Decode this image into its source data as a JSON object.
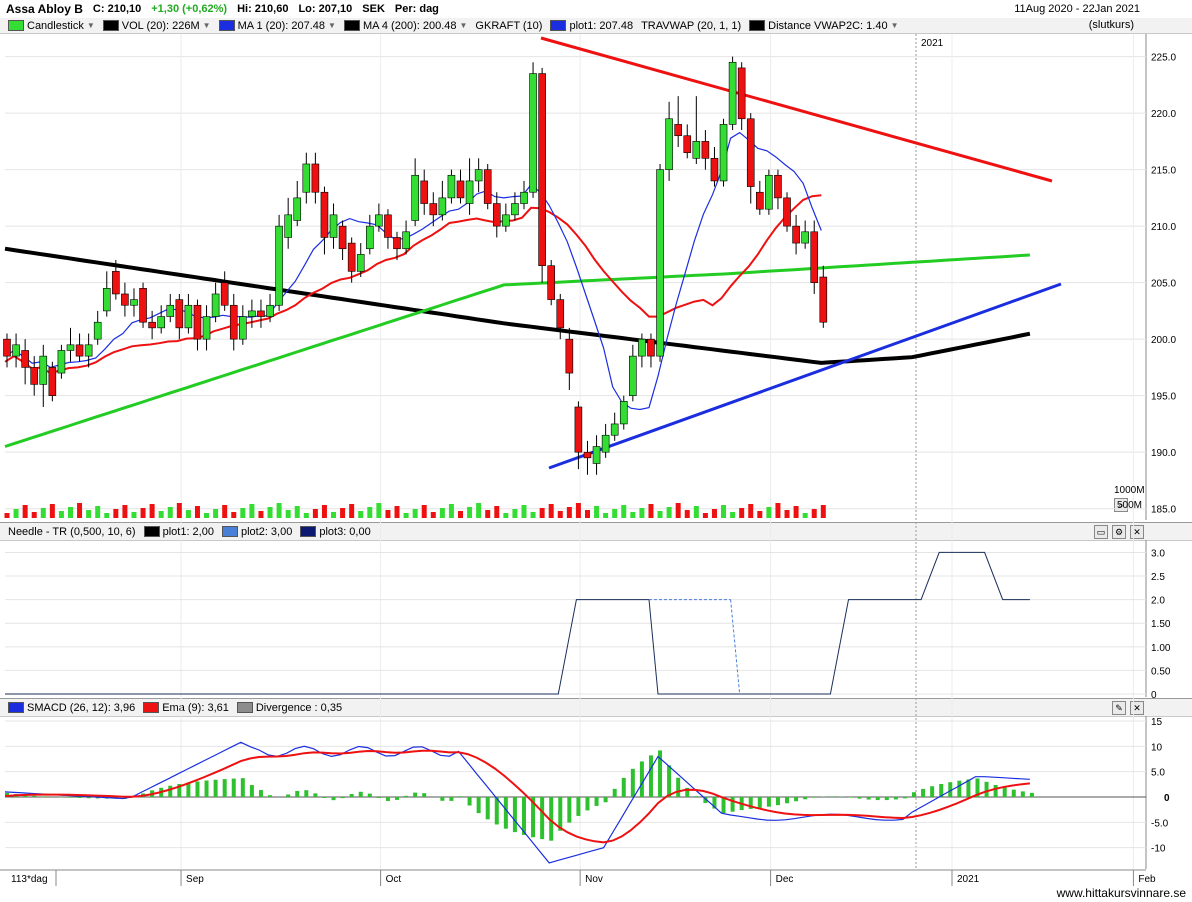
{
  "header": {
    "symbol": "Assa Abloy B",
    "close": "C: 210,10",
    "change": "+1,30 (+0,62%)",
    "high": "Hi: 210,60",
    "low": "Lo: 207,10",
    "currency": "SEK",
    "period": "Per: dag",
    "daterange": "11Aug 2020 - 22Jan 2021",
    "pricetype": "(slutkurs)"
  },
  "legend_price": [
    {
      "label": "Candlestick",
      "color": "#33dd33",
      "dropdown": true
    },
    {
      "label": "VOL (20): 226M",
      "color": "#000000",
      "dropdown": true
    },
    {
      "label": "MA 1 (20): 207.48",
      "color": "#1a2ee0",
      "dropdown": true
    },
    {
      "label": "MA 4 (200): 200.48",
      "color": "#000000",
      "dropdown": true
    },
    {
      "label": "GKRAFT (10)",
      "color": "",
      "dropdown": false
    },
    {
      "label": "plot1: 207.48",
      "color": "#1a2ee0",
      "dropdown": false
    },
    {
      "label": "TRAVWAP (20, 1, 1)",
      "color": "",
      "dropdown": false
    },
    {
      "label": "Distance VWAP2C: 1.40",
      "color": "#000000",
      "dropdown": true
    }
  ],
  "legend_needle": [
    {
      "label": "Needle - TR (0,500, 10, 6)",
      "color": ""
    },
    {
      "label": "plot1: 2,00",
      "color": "#000000"
    },
    {
      "label": "plot2: 3,00",
      "color": "#4a7fd8"
    },
    {
      "label": "plot3: 0,00",
      "color": "#0b1a70"
    }
  ],
  "legend_macd": [
    {
      "label": "SMACD (26, 12): 3,96",
      "color": "#1a2ee0"
    },
    {
      "label": "Ema (9): 3,61",
      "color": "#ee1111"
    },
    {
      "label": "Divergence : 0,35",
      "color": "#8c8c8c"
    }
  ],
  "year_marker": "2021",
  "x_ticks": [
    {
      "label": "113*dag",
      "i": -1
    },
    {
      "label": "Sep",
      "i": 15
    },
    {
      "label": "Oct",
      "i": 37
    },
    {
      "label": "Nov",
      "i": 59
    },
    {
      "label": "Dec",
      "i": 80
    },
    {
      "label": "2021",
      "i": 100
    },
    {
      "label": "Feb",
      "i": 120
    }
  ],
  "footer": "www.hittakursvinnare.se",
  "colors": {
    "up": "#33dd33",
    "down": "#ee1111",
    "ma20": "#1a2ee0",
    "ma200": "#000000",
    "ma50": "#22cc22",
    "red_ma": "#ee1111"
  },
  "chart_data": [
    {
      "type": "candlestick",
      "title": "Assa Abloy B",
      "ylim": [
        184,
        227
      ],
      "y_ticks": [
        185,
        190,
        195,
        200,
        205,
        210,
        215,
        220,
        225
      ],
      "volume_labels": [
        "1000M",
        "500M"
      ],
      "candles": [
        [
          200.0,
          198.5,
          200.5,
          197.5
        ],
        [
          198.5,
          199.5,
          200.5,
          197.5
        ],
        [
          199.0,
          197.5,
          200.0,
          196.0
        ],
        [
          197.5,
          196.0,
          198.5,
          195.0
        ],
        [
          196.0,
          198.5,
          199.5,
          194.0
        ],
        [
          197.5,
          195.0,
          198.0,
          194.5
        ],
        [
          197.0,
          199.0,
          199.5,
          196.5
        ],
        [
          199.0,
          199.5,
          201.0,
          198.0
        ],
        [
          199.5,
          198.5,
          200.5,
          198.0
        ],
        [
          198.5,
          199.5,
          200.5,
          197.5
        ],
        [
          200.0,
          201.5,
          202.5,
          199.5
        ],
        [
          202.5,
          204.5,
          206.0,
          202.0
        ],
        [
          206.0,
          204.0,
          207.0,
          203.5
        ],
        [
          204.0,
          203.0,
          205.0,
          202.0
        ],
        [
          203.0,
          203.5,
          204.5,
          202.0
        ],
        [
          204.5,
          201.5,
          205.0,
          201.0
        ],
        [
          201.5,
          201.0,
          202.5,
          200.0
        ],
        [
          201.0,
          202.0,
          203.0,
          200.5
        ],
        [
          202.0,
          203.0,
          204.0,
          201.5
        ],
        [
          203.5,
          201.0,
          204.0,
          200.0
        ],
        [
          201.0,
          203.0,
          204.0,
          200.5
        ],
        [
          203.0,
          200.0,
          203.5,
          199.0
        ],
        [
          200.0,
          202.0,
          203.0,
          199.0
        ],
        [
          202.0,
          204.0,
          205.0,
          201.5
        ],
        [
          205.0,
          203.0,
          206.0,
          202.5
        ],
        [
          203.0,
          200.0,
          204.0,
          199.0
        ],
        [
          200.0,
          202.0,
          203.0,
          199.5
        ],
        [
          202.0,
          202.5,
          203.5,
          201.0
        ],
        [
          202.5,
          202.0,
          203.5,
          201.0
        ],
        [
          202.0,
          203.0,
          204.0,
          201.5
        ],
        [
          203.0,
          210.0,
          211.0,
          202.5
        ],
        [
          209.0,
          211.0,
          212.5,
          208.0
        ],
        [
          210.5,
          212.5,
          214.0,
          210.0
        ],
        [
          213.0,
          215.5,
          216.5,
          212.0
        ],
        [
          215.5,
          213.0,
          216.5,
          212.0
        ],
        [
          213.0,
          209.0,
          213.5,
          207.5
        ],
        [
          209.0,
          211.0,
          212.0,
          208.0
        ],
        [
          210.0,
          208.0,
          210.5,
          207.0
        ],
        [
          208.5,
          206.0,
          209.0,
          205.0
        ],
        [
          206.0,
          207.5,
          208.5,
          205.5
        ],
        [
          208.0,
          210.0,
          211.0,
          207.5
        ],
        [
          210.0,
          211.0,
          212.0,
          209.5
        ],
        [
          211.0,
          209.0,
          211.5,
          208.0
        ],
        [
          209.0,
          208.0,
          209.5,
          207.0
        ],
        [
          208.0,
          209.5,
          210.5,
          207.5
        ],
        [
          210.5,
          214.5,
          216.0,
          210.0
        ],
        [
          214.0,
          212.0,
          215.0,
          211.0
        ],
        [
          212.0,
          211.0,
          213.0,
          210.0
        ],
        [
          211.0,
          212.5,
          214.0,
          210.5
        ],
        [
          212.5,
          214.5,
          215.0,
          212.0
        ],
        [
          214.0,
          212.5,
          215.0,
          212.0
        ],
        [
          212.0,
          214.0,
          216.0,
          211.0
        ],
        [
          214.0,
          215.0,
          216.0,
          213.0
        ],
        [
          215.0,
          212.0,
          215.5,
          211.5
        ],
        [
          212.0,
          210.0,
          213.0,
          209.0
        ],
        [
          210.0,
          211.0,
          212.0,
          209.5
        ],
        [
          211.0,
          212.0,
          213.0,
          210.5
        ],
        [
          212.0,
          213.0,
          214.0,
          211.5
        ],
        [
          213.0,
          223.5,
          224.5,
          212.5
        ],
        [
          223.5,
          206.5,
          224.0,
          205.0
        ],
        [
          206.5,
          203.5,
          207.0,
          203.0
        ],
        [
          203.5,
          201.0,
          204.0,
          200.0
        ],
        [
          200.0,
          197.0,
          201.0,
          195.5
        ],
        [
          194.0,
          190.0,
          194.5,
          188.5
        ],
        [
          190.0,
          189.5,
          191.0,
          188.0
        ],
        [
          189.0,
          190.5,
          191.5,
          188.0
        ],
        [
          190.0,
          191.5,
          192.5,
          189.5
        ],
        [
          191.5,
          192.5,
          193.5,
          191.0
        ],
        [
          192.5,
          194.5,
          195.0,
          192.0
        ],
        [
          195.0,
          198.5,
          199.5,
          194.5
        ],
        [
          198.5,
          200.0,
          200.5,
          197.5
        ],
        [
          200.0,
          198.5,
          200.5,
          197.5
        ],
        [
          198.5,
          215.0,
          215.5,
          198.0
        ],
        [
          215.0,
          219.5,
          221.0,
          214.0
        ],
        [
          219.0,
          218.0,
          221.5,
          217.0
        ],
        [
          218.0,
          216.5,
          219.0,
          216.0
        ],
        [
          216.0,
          217.5,
          221.5,
          215.5
        ],
        [
          217.5,
          216.0,
          218.5,
          215.0
        ],
        [
          216.0,
          214.0,
          217.0,
          213.5
        ],
        [
          214.0,
          219.0,
          219.5,
          213.5
        ],
        [
          219.0,
          224.5,
          225.0,
          218.5
        ],
        [
          224.0,
          219.5,
          224.5,
          218.5
        ],
        [
          219.5,
          213.5,
          220.0,
          212.0
        ],
        [
          213.0,
          211.5,
          214.0,
          211.0
        ],
        [
          211.5,
          214.5,
          215.0,
          211.0
        ],
        [
          214.5,
          212.5,
          215.0,
          211.5
        ],
        [
          212.5,
          210.0,
          213.0,
          209.5
        ],
        [
          210.0,
          208.5,
          211.0,
          207.5
        ],
        [
          208.5,
          209.5,
          210.5,
          208.0
        ],
        [
          209.5,
          205.0,
          210.5,
          204.0
        ],
        [
          205.5,
          201.5,
          206.5,
          201.0
        ]
      ],
      "ma20": [],
      "ma200": []
    },
    {
      "type": "line",
      "title": "Needle - TR (0,500, 10, 6)",
      "ylim": [
        0,
        3.2
      ],
      "y_ticks": [
        0,
        0.5,
        1.0,
        1.5,
        2.0,
        2.5,
        3.0
      ],
      "y_tick_labels": [
        "0",
        "0.50",
        "1.00",
        "1.50",
        "2.0",
        "2.5",
        "3.0"
      ],
      "plot1_segments": [
        {
          "from": 0,
          "to": 2.0,
          "i0": 61,
          "i1": 63
        },
        {
          "from": 2.0,
          "to": 2.0,
          "i0": 63,
          "i1": 71
        },
        {
          "from": 2.0,
          "to": 0,
          "i0": 71,
          "i1": 72
        }
      ],
      "plot2_dashed": [
        {
          "from": 2.0,
          "to": 2.0,
          "i0": 71,
          "i1": 80
        },
        {
          "from": 2.0,
          "to": 0,
          "i0": 80,
          "i1": 81
        }
      ],
      "plot_steps": [
        {
          "x": [
            0,
            61,
            63,
            71,
            72,
            91,
            93,
            101,
            103,
            108,
            110,
            113
          ],
          "y": [
            0,
            0,
            2,
            2,
            0,
            0,
            2,
            2,
            3,
            3,
            2,
            2
          ]
        }
      ]
    },
    {
      "type": "bar",
      "title": "SMACD (26, 12): 3,96",
      "ylim": [
        -15,
        15
      ],
      "y_ticks": [
        -15,
        -10,
        -5.0,
        0,
        5.0,
        10,
        15
      ],
      "y_tick_labels": [
        "-15",
        "-10",
        "-5.0",
        "0",
        "5.0",
        "10",
        "15"
      ]
    }
  ]
}
